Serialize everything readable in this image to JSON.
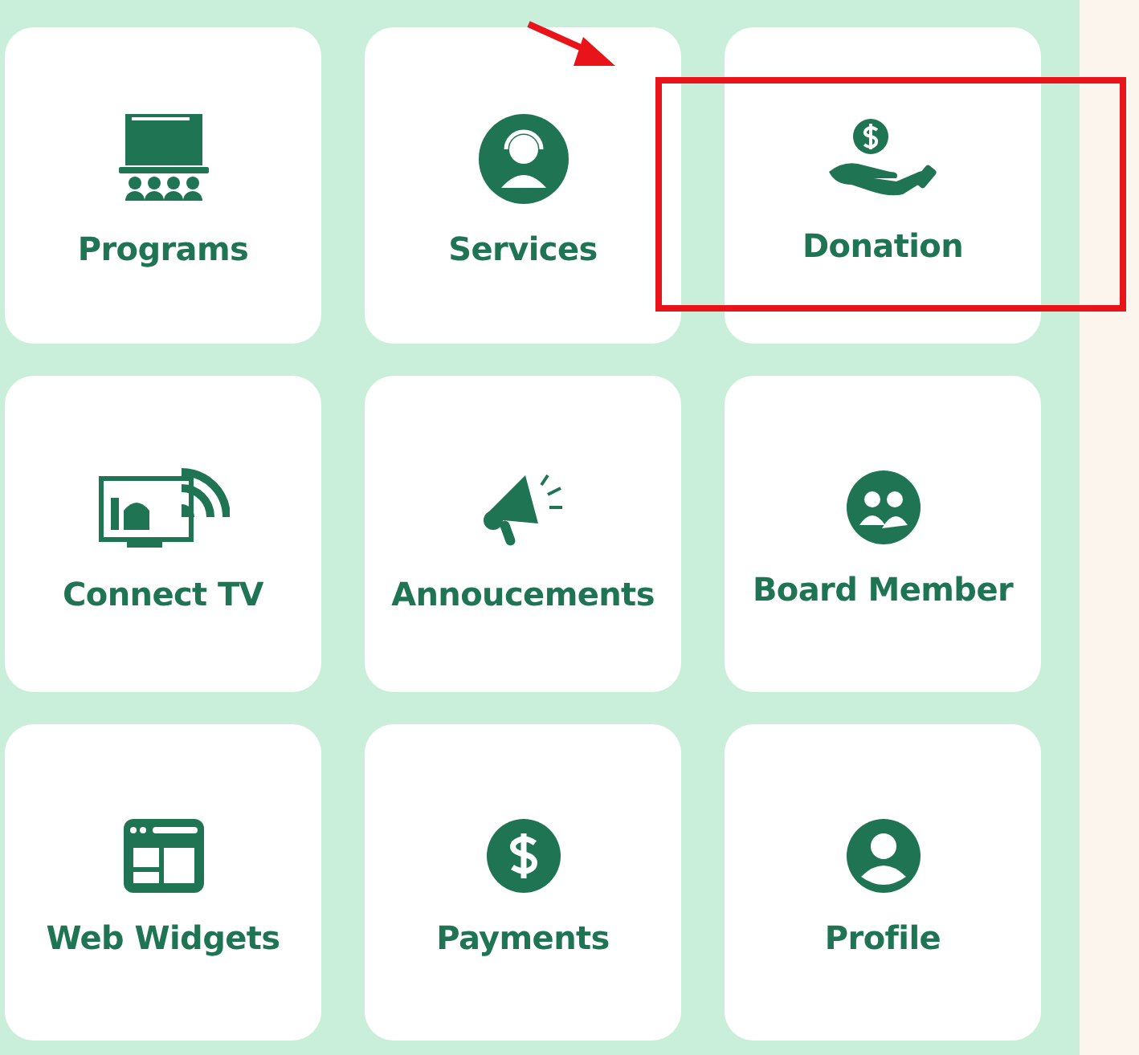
{
  "tiles": [
    {
      "kind": "programs",
      "label": "Programs",
      "highlighted": false
    },
    {
      "kind": "services",
      "label": "Services",
      "highlighted": false
    },
    {
      "kind": "donation",
      "label": "Donation",
      "highlighted": true
    },
    {
      "kind": "tv",
      "label": "Connect TV",
      "highlighted": false
    },
    {
      "kind": "announce",
      "label": "Annoucements",
      "highlighted": false
    },
    {
      "kind": "board",
      "label": "Board Member",
      "highlighted": false
    },
    {
      "kind": "widgets",
      "label": "Web Widgets",
      "highlighted": false
    },
    {
      "kind": "payments",
      "label": "Payments",
      "highlighted": false
    },
    {
      "kind": "profile",
      "label": "Profile",
      "highlighted": false
    }
  ]
}
